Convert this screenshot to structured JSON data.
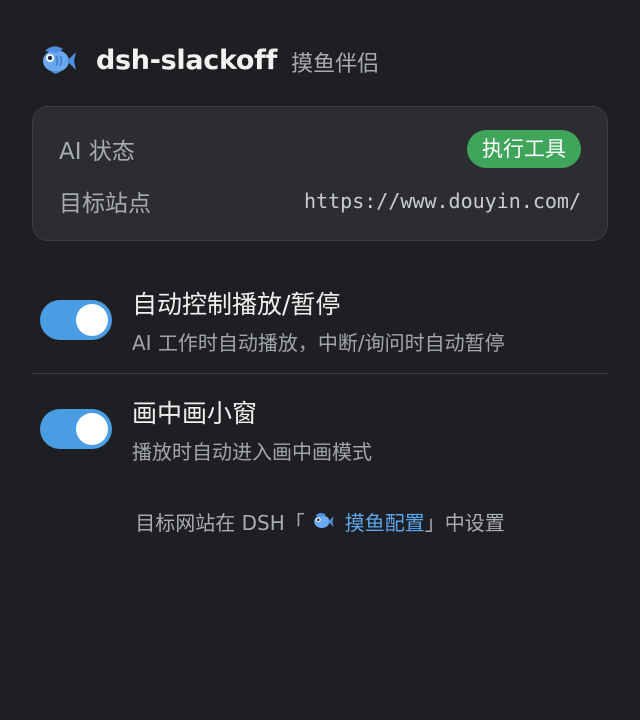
{
  "header": {
    "app_name": "dsh-slackoff",
    "subtitle": "摸鱼伴侣",
    "logo_icon": "fish-icon"
  },
  "status_card": {
    "ai_status_label": "AI 状态",
    "ai_status_badge": "执行工具",
    "badge_color": "#3fa55b",
    "target_site_label": "目标站点",
    "target_site_value": "https://www.douyin.com/"
  },
  "settings": [
    {
      "title": "自动控制播放/暂停",
      "description": "AI 工作时自动播放，中断/询问时自动暂停",
      "enabled": true
    },
    {
      "title": "画中画小窗",
      "description": "播放时自动进入画中画模式",
      "enabled": true
    }
  ],
  "footer": {
    "prefix": "目标网站在 DSH「",
    "link_text": "摸鱼配置",
    "suffix": "」中设置",
    "link_icon": "fish-icon"
  },
  "colors": {
    "background": "#1e1f22",
    "card": "#2b2d31",
    "toggle_on": "#4a9de3",
    "link": "#5aa7ee"
  }
}
